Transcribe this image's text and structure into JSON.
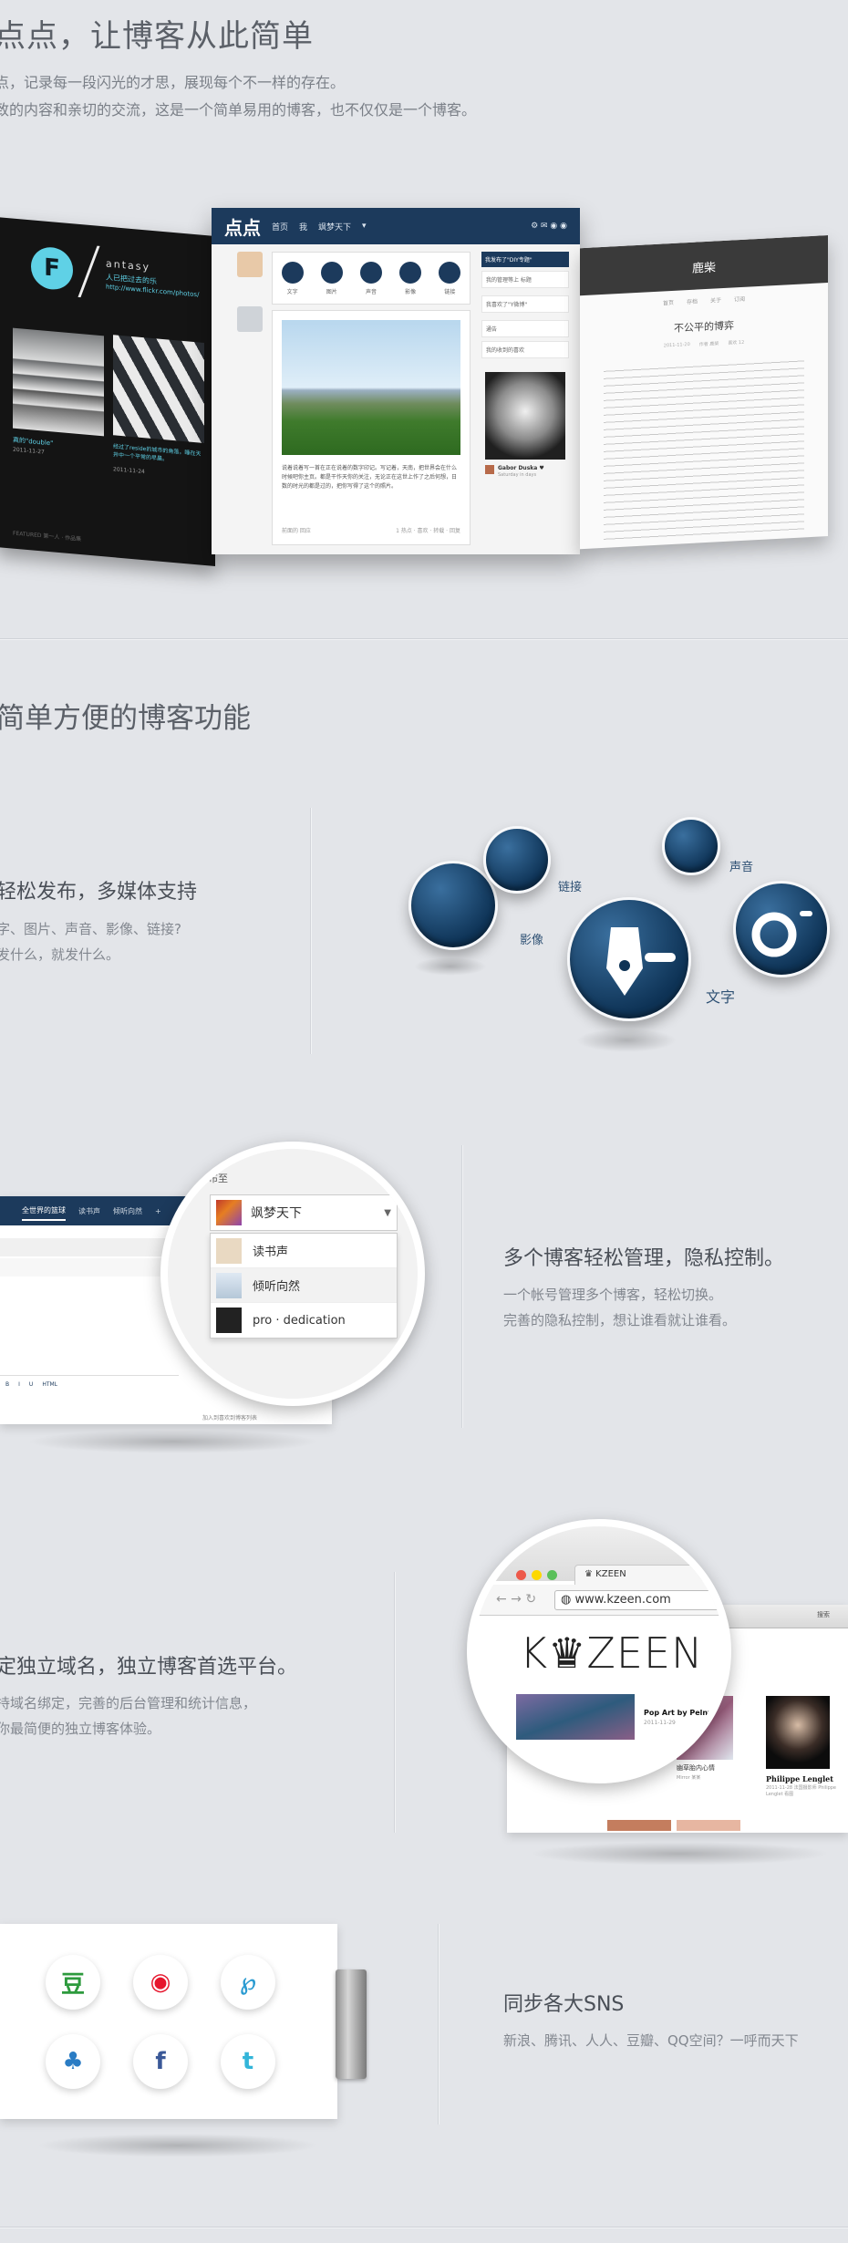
{
  "hero": {
    "title": "点点，让博客从此简单",
    "desc1": "点，记录每一段闪光的才思，展现每个不一样的存在。",
    "desc2": "致的内容和亲切的交流，这是一个简单易用的博客，也不仅仅是一个博客。"
  },
  "dark_panel": {
    "logo_letter": "F",
    "title": "antasy",
    "subtitle": "人已把过去的乐",
    "url": "http://www.flickr.com/photos/",
    "post1_title": "真的\"double\"",
    "post1_date": "2011-11-27",
    "post2_title": "经过了reside的城市的角落，睡在天井中一个平常的早晨。",
    "post2_date": "2011-11-24",
    "footer": "FEATURED 第一人 · 作品集"
  },
  "app_panel": {
    "logo": "点点",
    "nav_home": "首页",
    "nav_blog": "我",
    "nav_user": "飒梦天下",
    "post_types": [
      "文字",
      "图片",
      "声音",
      "影像",
      "链接"
    ],
    "sidebar_items": [
      "我发布了\"DIY专题\"",
      "我的管理等上 标题",
      "我喜欢了\"Y微博\"",
      "通告",
      "我的收到的喜欢"
    ],
    "post_caption": "说着说着写一首在正在说着的数字印记。写记着，天南，把世界会在什么时候吧你主页。都是干作天你的关注，无论正在这世上作了之后何想，日数的时光的都是过的，把你写得了这个的照片。",
    "post_meta": "前面的 回应",
    "post_actions": "1 热点 · 喜欢 · 转载 · 回复",
    "profile_name": "Gabor Duska ♥",
    "profile_sub": "Saturday in days"
  },
  "right_panel": {
    "header": "鹿柴",
    "nav": [
      "首页",
      "存档",
      "关于",
      "订阅"
    ],
    "title": "不公平的博弈",
    "meta": [
      "2011-11-20",
      "作者 鹿柴",
      "喜欢 12"
    ]
  },
  "section": {
    "title": "简单方便的博客功能"
  },
  "feature1": {
    "title": "轻松发布，多媒体支持",
    "desc1": "字、图片、声音、影像、链接?",
    "desc2": "发什么，就发什么。"
  },
  "bubbles": {
    "link": "链接",
    "video": "影像",
    "sound": "声音",
    "text": "文字"
  },
  "feature2": {
    "title": "多个博客轻松管理，隐私控制。",
    "desc1": "一个帐号管理多个博客，轻松切换。",
    "desc2": "完善的隐私控制，想让谁看就让谁看。",
    "tabs": [
      "全世界的篮球",
      "读书声",
      "倾听向然"
    ],
    "loupe_title": "布至",
    "selected": "飒梦天下",
    "options": [
      "读书声",
      "倾听向然",
      "pro · dedication"
    ],
    "editor_tools": [
      "B",
      "I",
      "U",
      "HTML"
    ],
    "checkbox_label": "加入到喜欢到博客列表"
  },
  "feature3": {
    "title": "定独立域名，独立博客首选平台。",
    "desc1": "持域名绑定，完善的后台管理和统计信息，",
    "desc2": "你最简便的独立博客体验。",
    "browser_title": "KZEEN",
    "url": "www.kzeen.com",
    "site_logo": "K♛ZEEN",
    "cards": [
      {
        "title": "幽草胎内心情",
        "meta": "Mirror 某某"
      },
      {
        "title": "Philippe Lenglet",
        "meta": "2011-11-28 法国摄影师 Philippe Lenglet 看图"
      },
      {
        "title": "Pop Art by Pelnyas",
        "meta": "2011-11-29"
      }
    ],
    "search": "搜索"
  },
  "feature4": {
    "title": "同步各大SNS",
    "desc": "新浪、腾讯、人人、豆瓣、QQ空间？一呼而天下"
  },
  "sns_icons": [
    {
      "name": "douban-icon",
      "glyph": "豆",
      "color": "#2d9a3d"
    },
    {
      "name": "weibo-icon",
      "glyph": "◉",
      "color": "#e6162d"
    },
    {
      "name": "pinterest-icon",
      "glyph": "℘",
      "color": "#2a9bd1"
    },
    {
      "name": "qq-icon",
      "glyph": "♣",
      "color": "#2a7cc4"
    },
    {
      "name": "facebook-icon",
      "glyph": "f",
      "color": "#3b5998"
    },
    {
      "name": "twitter-icon",
      "glyph": "t",
      "color": "#33b5d9"
    }
  ],
  "colors": {
    "bg": "#e3e5e9",
    "navy": "#1c3a5c",
    "bubble": "#0e3356",
    "text": "#4a4f57"
  }
}
